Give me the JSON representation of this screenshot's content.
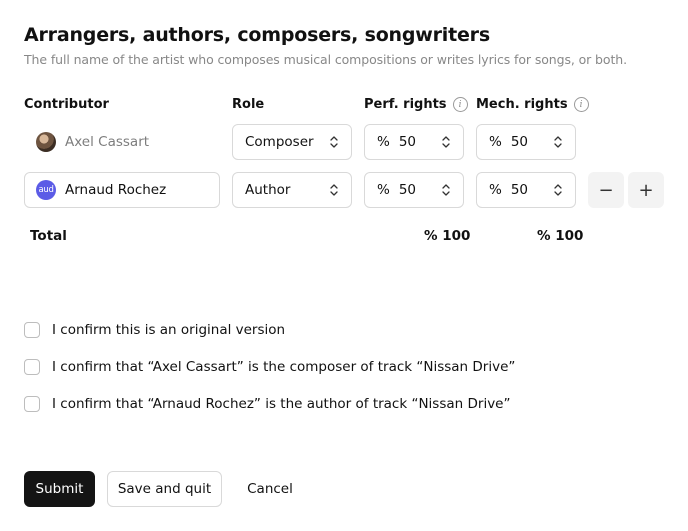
{
  "section": {
    "title": "Arrangers, authors, composers, songwriters",
    "subtitle": "The full name of the artist who composes musical compositions or writes lyrics for songs, or both."
  },
  "columns": {
    "contributor": "Contributor",
    "role": "Role",
    "perf_rights": "Perf. rights",
    "mech_rights": "Mech. rights",
    "info_glyph": "i"
  },
  "rows": [
    {
      "contributor": "Axel Cassart",
      "avatar": "photo",
      "role": "Composer",
      "perf_symbol": "%",
      "perf_value": "50",
      "mech_symbol": "%",
      "mech_value": "50"
    },
    {
      "contributor": "Arnaud Rochez",
      "avatar_initials": "aud",
      "role": "Author",
      "perf_symbol": "%",
      "perf_value": "50",
      "mech_symbol": "%",
      "mech_value": "50"
    }
  ],
  "stepper": {
    "minus": "−",
    "plus": "+"
  },
  "totals": {
    "label": "Total",
    "perf": "% 100",
    "mech": "% 100"
  },
  "confirmations": [
    "I confirm this is an original version",
    "I confirm that “Axel Cassart” is the composer of track “Nissan Drive”",
    "I confirm that “Arnaud Rochez” is the author of track “Nissan Drive”"
  ],
  "buttons": {
    "submit": "Submit",
    "save_quit": "Save and quit",
    "cancel": "Cancel"
  },
  "colors": {
    "primary": "#141414",
    "avatar_accent": "#5b5be6",
    "muted_text": "#888888",
    "border": "#d9d9d9"
  },
  "icons": {
    "select_chevron": "chevron-up-down-icon",
    "info": "info-icon",
    "avatar_photo": "avatar"
  }
}
